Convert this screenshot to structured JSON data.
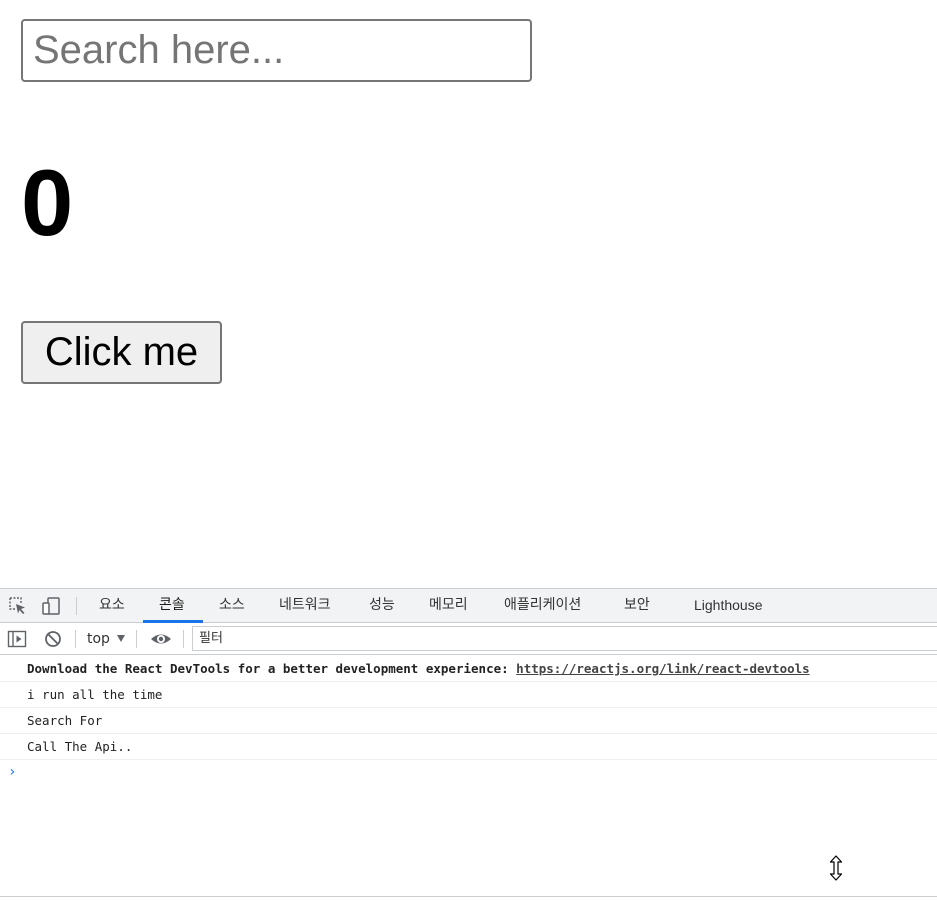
{
  "page": {
    "search_placeholder": "Search here...",
    "counter_value": "0",
    "button_label": "Click me"
  },
  "devtools": {
    "tabs": [
      {
        "label": "요소"
      },
      {
        "label": "콘솔"
      },
      {
        "label": "소스"
      },
      {
        "label": "네트워크"
      },
      {
        "label": "성능"
      },
      {
        "label": "메모리"
      },
      {
        "label": "애플리케이션"
      },
      {
        "label": "보안"
      },
      {
        "label": "Lighthouse"
      }
    ],
    "active_tab": "콘솔",
    "context": "top",
    "filter_placeholder": "필터",
    "logs": [
      {
        "text": "Download the React DevTools for a better development experience: ",
        "link": "https://reactjs.org/link/react-devtools"
      },
      {
        "text": "i run all the time"
      },
      {
        "text": "Search For"
      },
      {
        "text": "Call The Api.."
      }
    ],
    "prompt_symbol": "›"
  },
  "colors": {
    "accent": "#1a73e8",
    "devtools_bar": "#f1f3f4",
    "border": "#cacdd1"
  },
  "icons": {
    "inspect": "inspect-element-icon",
    "device": "device-toolbar-icon",
    "sidebar": "show-sidebar-icon",
    "clear": "clear-console-icon",
    "eye": "live-expression-icon"
  }
}
